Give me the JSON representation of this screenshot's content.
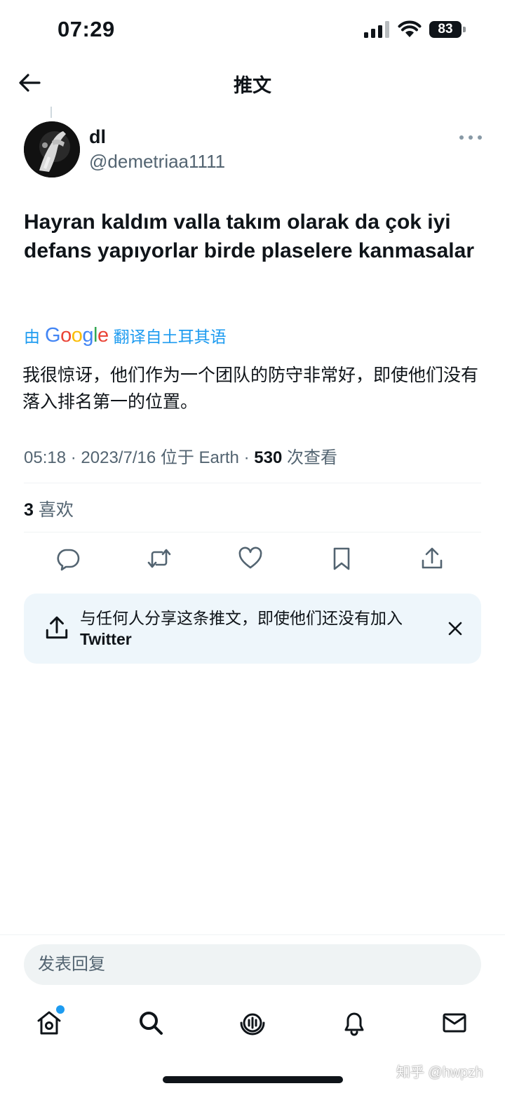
{
  "status_bar": {
    "time": "07:29",
    "battery_level": "83",
    "icons": [
      "signal-icon",
      "wifi-icon",
      "battery-icon"
    ]
  },
  "header": {
    "title": "推文",
    "back_icon": "arrow-left-icon"
  },
  "tweet": {
    "display_name": "dl",
    "handle": "@demetriaa1111",
    "text": "Hayran kaldım valla takım olarak da çok iyi defans yapıyorlar birde plaselere kanmasalar",
    "translation": {
      "prefix": "由",
      "provider": "Google",
      "suffix": "翻译自土耳其语",
      "text": "我很惊讶，他们作为一个团队的防守非常好，即使他们没有落入排名第一的位置。"
    },
    "meta": {
      "time": "05:18",
      "date": "2023/7/16",
      "location_prefix": "位于",
      "location": "Earth",
      "views": "530",
      "views_label": "次查看",
      "separator": "·"
    },
    "likes": {
      "count": "3",
      "label": "喜欢"
    }
  },
  "actions": [
    "reply-icon",
    "retweet-icon",
    "like-icon",
    "bookmark-icon",
    "share-icon"
  ],
  "share_banner": {
    "text": "与任何人分享这条推文，即使他们还没有加入",
    "brand": "Twitter"
  },
  "reply": {
    "placeholder": "发表回复"
  },
  "tab_bar": [
    "home-icon",
    "search-icon",
    "spaces-icon",
    "notifications-icon",
    "messages-icon"
  ],
  "watermark": "知乎 @hwpzh",
  "colors": {
    "accent": "#1d9bf0",
    "text_primary": "#0f1419",
    "text_secondary": "#536471",
    "banner_bg": "#eef6fb"
  }
}
